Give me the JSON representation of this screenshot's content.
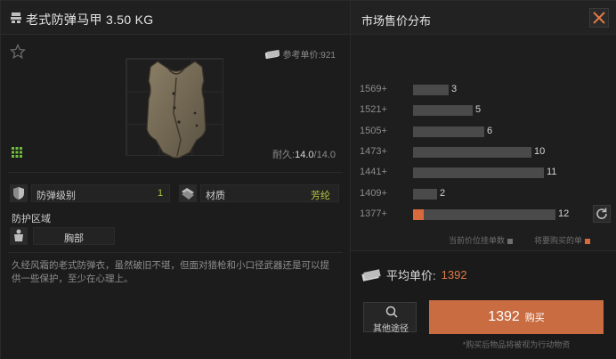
{
  "item": {
    "title": "老式防弹马甲 3.50 KG",
    "ref_price": "参考单价:921",
    "durability_label": "耐久:",
    "durability_current": "14.0",
    "durability_max": "/14.0"
  },
  "stats": {
    "armor_label": "防弹级别",
    "armor_value": "1",
    "material_label": "材质",
    "material_value": "芳纶",
    "zone_title": "防护区域",
    "zone_value": "胸部"
  },
  "description": "久经风霜的老式防弹衣，虽然破旧不堪，但面对猎枪和小口径武器还是可以提供一些保护，至少在心理上。",
  "market": {
    "title": "市场售价分布",
    "legend_listed": "当前价位挂单数",
    "legend_buy": "将要购买的单",
    "avg_label": "平均单价:",
    "avg_value": "1392",
    "other_label": "其他途径",
    "buy_price": "1392",
    "buy_label": "购买",
    "note": "*购买后物品将被视为行动物资"
  },
  "colors": {
    "accent": "#c96c42",
    "armor_value": "#a6c93b",
    "material_value": "#b8c93b"
  },
  "chart_data": {
    "type": "bar",
    "orientation": "horizontal",
    "categories": [
      "1569+",
      "1521+",
      "1505+",
      "1473+",
      "1441+",
      "1409+",
      "1377+"
    ],
    "series": [
      {
        "values": [
          3,
          5,
          6,
          10,
          11,
          2,
          12
        ]
      }
    ],
    "highlight": {
      "category": "1377+",
      "color": "#d86a3b"
    },
    "title": "",
    "xlabel": "",
    "ylabel": ""
  }
}
